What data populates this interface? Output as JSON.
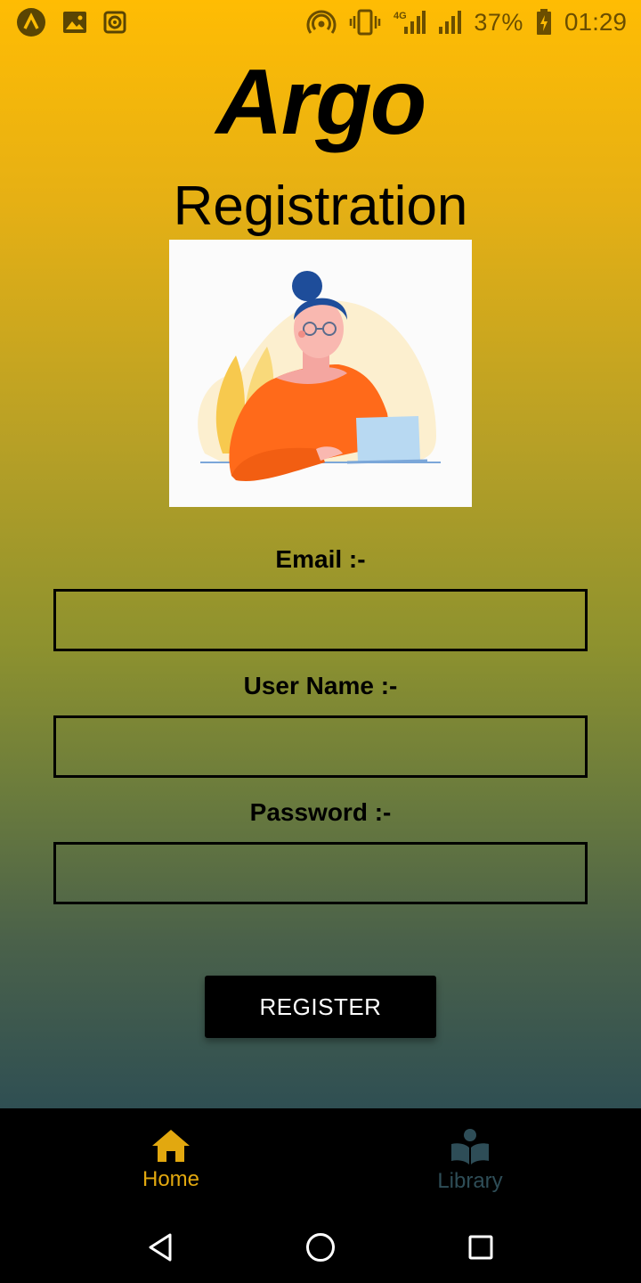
{
  "status_bar": {
    "battery": "37%",
    "time": "01:29",
    "network": "4G",
    "icons": [
      "argo-app-icon",
      "image-icon",
      "speaker-icon",
      "hotspot-icon",
      "vibrate-icon",
      "signal-4g-icon",
      "signal-icon",
      "battery-charging-icon"
    ]
  },
  "app": {
    "title": "Argo",
    "page_title": "Registration",
    "illustration": "woman-at-laptop-illustration"
  },
  "form": {
    "email_label": "Email :-",
    "email_value": "",
    "username_label": "User Name :-",
    "username_value": "",
    "password_label": "Password :-",
    "password_value": "",
    "register_label": "REGISTER"
  },
  "bottom_nav": {
    "tabs": [
      {
        "label": "Home",
        "icon": "home-icon",
        "active": true
      },
      {
        "label": "Library",
        "icon": "library-icon",
        "active": false
      }
    ]
  },
  "system_nav": {
    "icons": [
      "back-icon",
      "home-circle-icon",
      "recents-icon"
    ]
  },
  "colors": {
    "gradient_top": "#FFBC03",
    "gradient_bottom": "#2F4F53",
    "active_tab": "#E2A80F",
    "inactive_tab": "#2E4D57",
    "button_bg": "#000000"
  }
}
